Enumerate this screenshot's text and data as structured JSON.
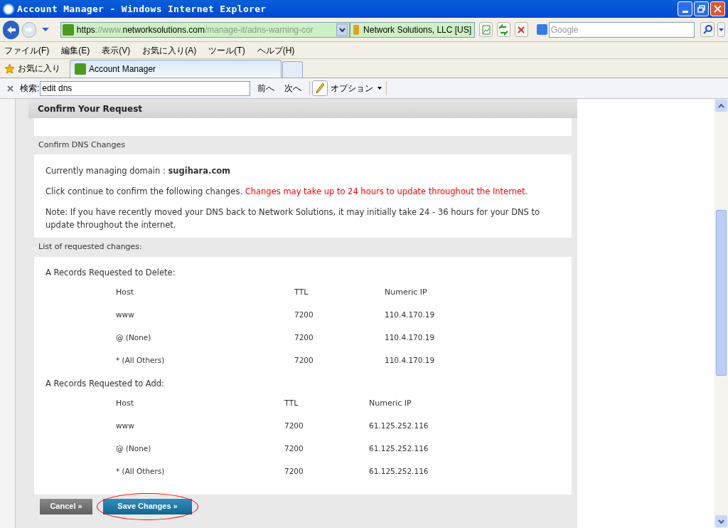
{
  "window": {
    "title": "Account Manager - Windows Internet Explorer"
  },
  "address_bar": {
    "url_parts": [
      {
        "text": "https",
        "dim": false
      },
      {
        "text": "://www.",
        "dim": true
      },
      {
        "text": "networksolutions.com",
        "dim": false
      },
      {
        "text": "/manage-it/adns-warning-cor",
        "dim": true
      }
    ],
    "certificate": "Network Solutions, LLC [US]"
  },
  "search_box": {
    "placeholder": "Google"
  },
  "menu": [
    "ファイル(F)",
    "編集(E)",
    "表示(V)",
    "お気に入り(A)",
    "ツール(T)",
    "ヘルプ(H)"
  ],
  "favorites": "お気に入り",
  "tabs": [
    {
      "label": "Account Manager",
      "selected": true
    }
  ],
  "find_bar": {
    "label": "検索:",
    "value": "edit dns",
    "previous": "前へ",
    "next": "次へ",
    "options": "オプション"
  },
  "page": {
    "heading": "Confirm Your Request",
    "section": "Confirm DNS Changes",
    "domain_label": "Currently managing domain : ",
    "domain": "sugihara.com",
    "confirm_text": "Click continue to confirm the following changes.",
    "warning": "Changes may take up to 24 hours to update throughout the Internet.",
    "note": "Note: If you have recently moved your DNS back to Network Solutions, it may initially take 24 - 36 hours for your DNS to update throughout the internet.",
    "list_heading": "List of requested changes:",
    "groups": [
      {
        "title": "A Records Requested to Delete:",
        "columns": [
          "Host",
          "TTL",
          "Numeric IP"
        ],
        "rows": [
          [
            "www",
            "7200",
            "110.4.170.19"
          ],
          [
            "@ (None)",
            "7200",
            "110.4.170.19"
          ],
          [
            "* (All Others)",
            "7200",
            "110.4.170.19"
          ]
        ]
      },
      {
        "title": "A Records Requested to Add:",
        "columns": [
          "Host",
          "TTL",
          "Numeric IP"
        ],
        "rows": [
          [
            "www",
            "7200",
            "61.125.252.116"
          ],
          [
            "@ (None)",
            "7200",
            "61.125.252.116"
          ],
          [
            "* (All Others)",
            "7200",
            "61.125.252.116"
          ]
        ]
      }
    ],
    "buttons": [
      {
        "label": "Cancel »",
        "kind": "secondary"
      },
      {
        "label": "Save Changes »",
        "kind": "primary",
        "circled": true
      }
    ]
  }
}
